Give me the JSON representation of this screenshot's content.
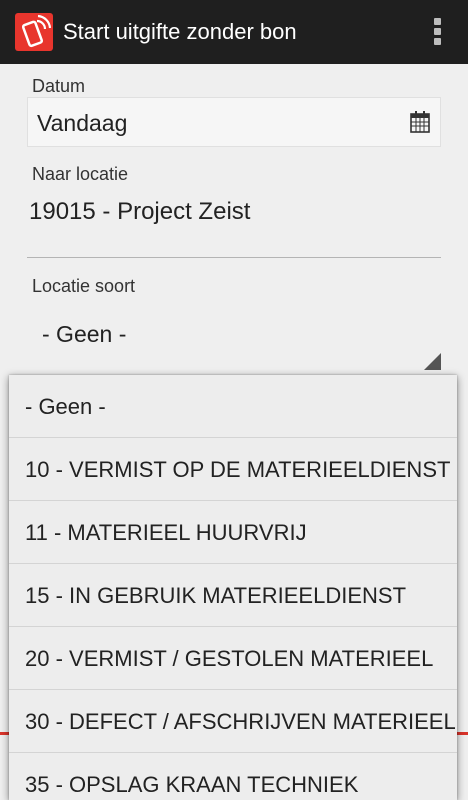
{
  "appbar": {
    "title": "Start uitgifte zonder bon",
    "accent_color": "#e8352d",
    "app_icon": "phone-signal-icon",
    "menu_icon": "overflow-menu-icon"
  },
  "form": {
    "date": {
      "label": "Datum",
      "value": "Vandaag",
      "icon": "calendar-icon"
    },
    "location": {
      "label": "Naar locatie",
      "value": "19015 - Project Zeist"
    },
    "location_type": {
      "label": "Locatie soort",
      "value": "- Geen -"
    }
  },
  "dropdown": {
    "options": [
      "- Geen -",
      "10 - VERMIST OP DE MATERIEELDIENST",
      "11 - MATERIEEL HUURVRIJ",
      "15 - IN GEBRUIK MATERIEELDIENST",
      "20 - VERMIST / GESTOLEN MATERIEEL",
      "30 - DEFECT / AFSCHRIJVEN MATERIEEL",
      "35 - OPSLAG KRAAN TECHNIEK"
    ]
  }
}
